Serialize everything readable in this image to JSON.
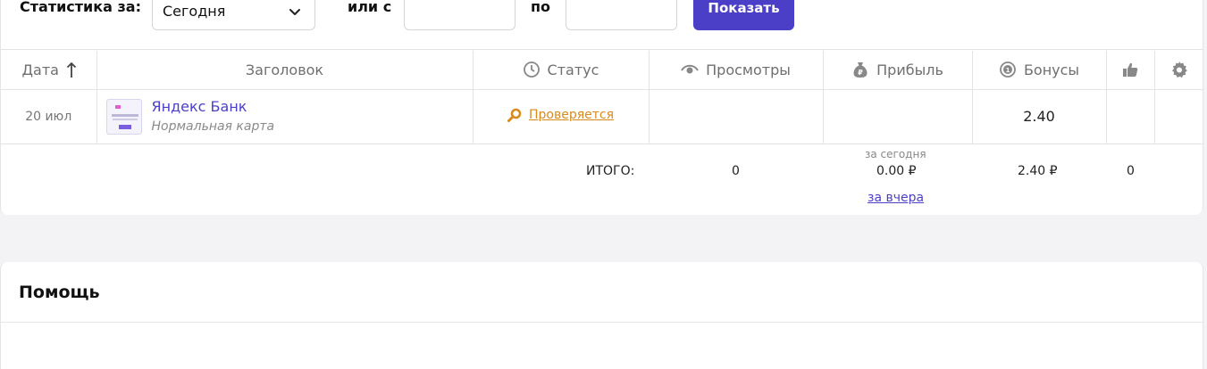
{
  "filters": {
    "stats_for_label": "Статистика за:",
    "period_selected": "Сегодня",
    "or_from_label": "или с",
    "to_label": "по",
    "date_from_value": "",
    "date_to_value": "",
    "show_button": "Показать"
  },
  "table": {
    "headers": {
      "date": "Дата",
      "title": "Заголовок",
      "status": "Статус",
      "views": "Просмотры",
      "profit": "Прибыль",
      "bonuses": "Бонусы"
    },
    "rows": [
      {
        "date": "20 июл",
        "title": "Яндекс Банк",
        "subtitle": "Нормальная карта",
        "status": "Проверяется",
        "views": "",
        "profit": "",
        "bonuses": "2.40",
        "likes": "",
        "settings": ""
      }
    ]
  },
  "totals": {
    "label": "ИТОГО:",
    "views": "0",
    "today_label": "за сегодня",
    "profit": "0.00 ₽",
    "yesterday_link": "за вчера",
    "bonuses": "2.40 ₽",
    "likes": "0"
  },
  "help": {
    "title": "Помощь"
  },
  "colors": {
    "accent": "#4b3fc8",
    "status_pending": "#d98a1c",
    "background": "#f3f3f5"
  },
  "icons": {
    "sort": "arrow-up-icon",
    "status": "clock-icon",
    "views": "eye-icon",
    "profit": "money-bag-icon",
    "bonuses": "coin-icon",
    "likes": "thumbs-up-icon",
    "settings": "gear-icon",
    "status_pending": "magnifier-icon"
  }
}
